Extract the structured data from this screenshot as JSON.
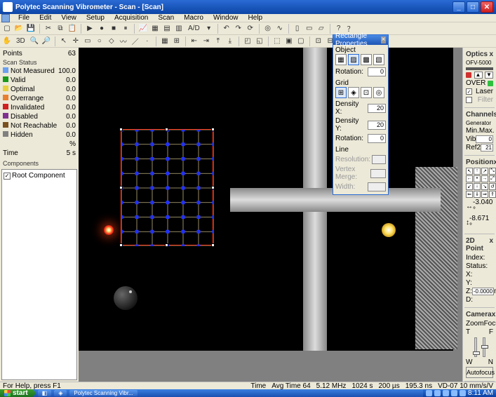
{
  "title": "Polytec Scanning Vibrometer - Scan - [Scan]",
  "menu": [
    "File",
    "Edit",
    "View",
    "Setup",
    "Acquisition",
    "Scan",
    "Macro",
    "Window",
    "Help"
  ],
  "toolbar1": {
    "ad_label": "A/D"
  },
  "toolbar2": {
    "threed": "3D"
  },
  "left": {
    "points_label": "Points",
    "points_value": "63",
    "scan_status": "Scan Status",
    "items": [
      {
        "label": "Not Measured",
        "value": "100.0",
        "color": "#6aa0f0"
      },
      {
        "label": "Valid",
        "value": "0.0",
        "color": "#1a9a1a"
      },
      {
        "label": "Optimal",
        "value": "0.0",
        "color": "#e8d040"
      },
      {
        "label": "Overrange",
        "value": "0.0",
        "color": "#e88030"
      },
      {
        "label": "Invalidated",
        "value": "0.0",
        "color": "#d02020"
      },
      {
        "label": "Disabled",
        "value": "0.0",
        "color": "#803090"
      },
      {
        "label": "Not Reachable",
        "value": "0.0",
        "color": "#7a5020"
      },
      {
        "label": "Hidden",
        "value": "0.0",
        "color": "#808080"
      }
    ],
    "pct": "%",
    "time_label": "Time",
    "time_value": "5 s",
    "components": "Components",
    "root": "Root Component",
    "root_checked": "✓"
  },
  "rect": {
    "title": "Rectangle Properties",
    "object": "Object",
    "rotation": "Rotation:",
    "rot_obj": "0",
    "grid": "Grid",
    "density_x": "Density X:",
    "dx": "20",
    "density_y": "Density Y:",
    "dy": "20",
    "grid_rot": "Rotation:",
    "grot": "0",
    "line": "Line",
    "resolution": "Resolution:",
    "vertex_merge": "Vertex Merge:",
    "width": "Width:"
  },
  "right": {
    "optics": "Optics",
    "optics_model": "OFV-5000",
    "over": "OVER",
    "laser": "Laser",
    "filter": "Filter",
    "laser_on": "✓",
    "channels": "Channels",
    "generator": "Generator",
    "min": "Min.",
    "max": "Max.",
    "vib": "Vib",
    "vib_val": "0",
    "ref2": "Ref2",
    "ref2_val": "21",
    "position": "Position",
    "pos_x": "-3.040 °",
    "pos_y": "-8.671 °",
    "twod": "2D Point",
    "index": "Index:",
    "status": "Status:",
    "xcoord": "X:",
    "ycoord": "Y:",
    "zcoord": "Z:",
    "dcoord": "D:",
    "zval": "-0.0000",
    "zunit": "m",
    "camera": "Camera",
    "zoom": "Zoom",
    "focus": "Focus",
    "t": "T",
    "f": "F",
    "w": "W",
    "n": "N",
    "autofocus": "Autofocus",
    "x_btn": "x"
  },
  "status": {
    "left": "For Help, press F1",
    "r1": "Time",
    "r2": "Avg Time 64",
    "r3": "5.12 MHz",
    "r4": "1024 s",
    "r5": "200 µs",
    "r6": "195.3 ns",
    "r7": "VD-07 10 mm/s/V"
  },
  "taskbar": {
    "start": "start",
    "app": "Polytec Scanning Vibr...",
    "clock": "8:11 AM"
  }
}
